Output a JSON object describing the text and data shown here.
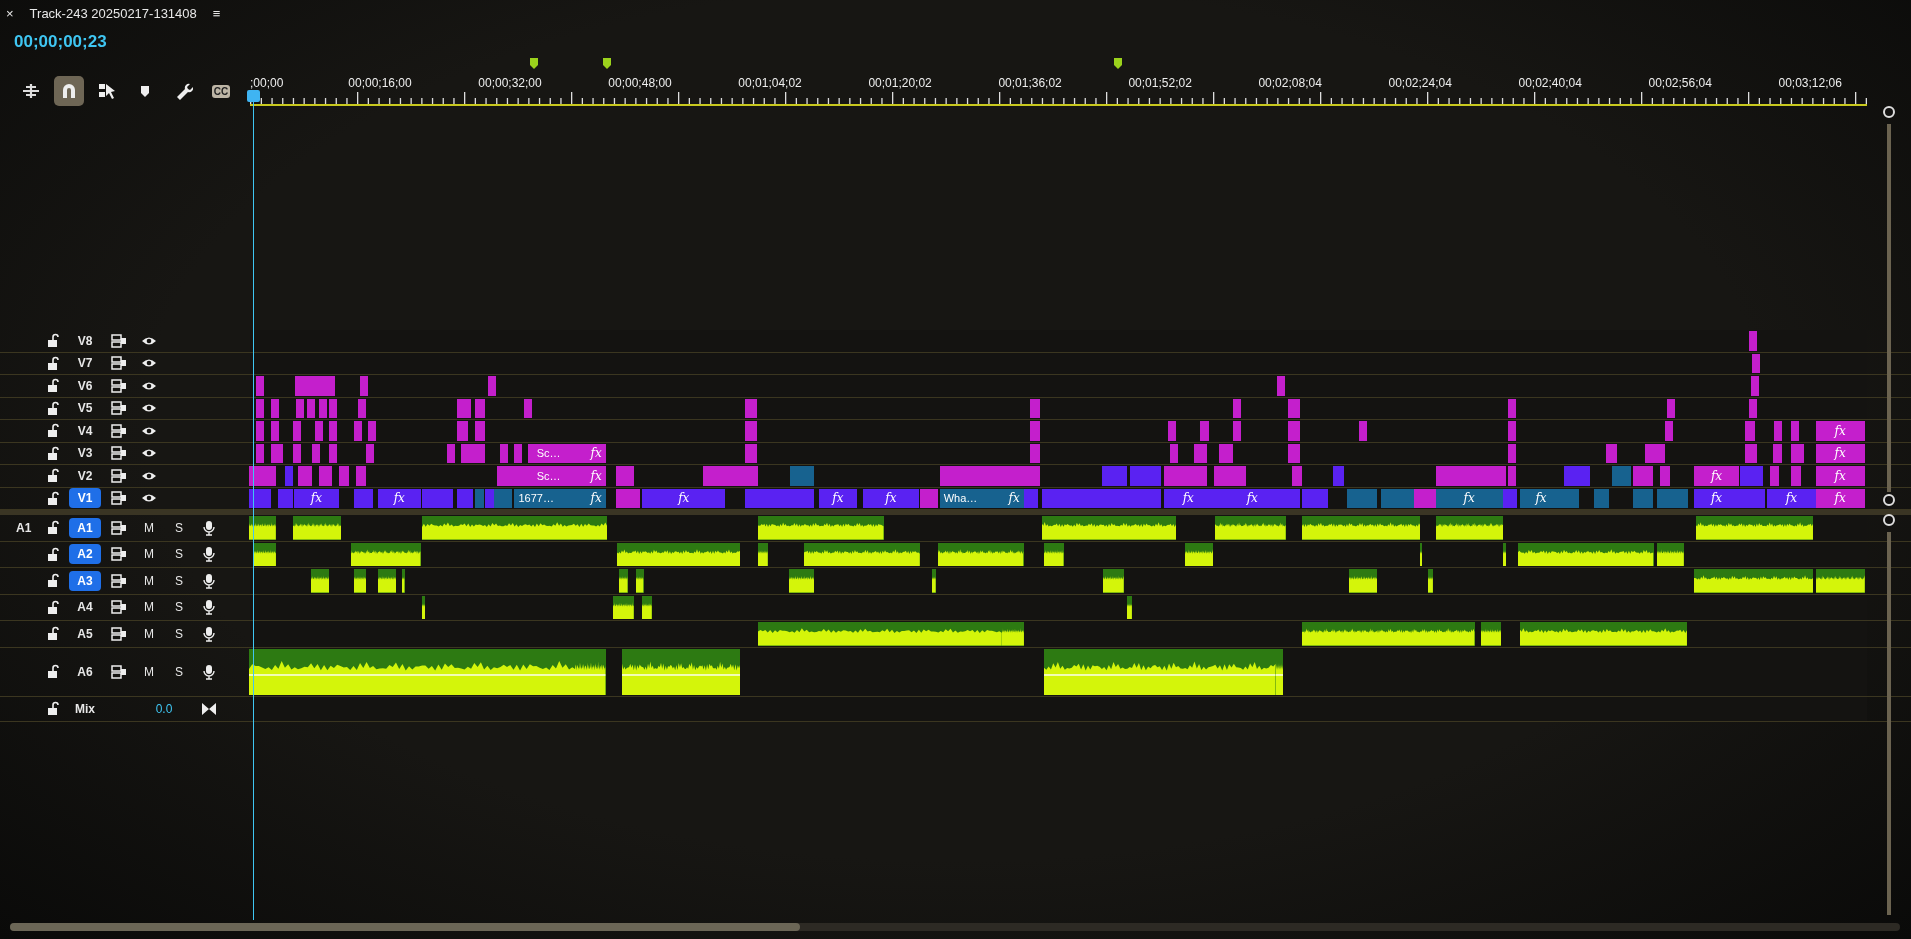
{
  "sequence": {
    "close": "×",
    "title": "Track-243 20250217-131408",
    "menu": "≡"
  },
  "timecode": "00;00;00;23",
  "tools": [
    {
      "kind": "nest",
      "on": false
    },
    {
      "kind": "snap",
      "on": true
    },
    {
      "kind": "linked",
      "on": false
    },
    {
      "kind": "marker",
      "on": false
    },
    {
      "kind": "settings",
      "on": false
    },
    {
      "kind": "captions",
      "label": "CC",
      "on": false
    }
  ],
  "ruler": {
    "labels": [
      ";00;00",
      "00;00;16;00",
      "00;00;32;00",
      "00;00;48;00",
      "00;01;04;02",
      "00;01;20;02",
      "00;01;36;02",
      "00;01;52;02",
      "00;02;08;04",
      "00;02;24;04",
      "00;02;40;04",
      "00;02;56;04",
      "00;03;12;06"
    ]
  },
  "video_tracks": [
    {
      "name": "V8",
      "selected": false
    },
    {
      "name": "V7",
      "selected": false
    },
    {
      "name": "V6",
      "selected": false
    },
    {
      "name": "V5",
      "selected": false
    },
    {
      "name": "V4",
      "selected": false,
      "clips": [
        {
          "fx": "fx",
          "color": "#c41fcc"
        }
      ]
    },
    {
      "name": "V3",
      "selected": false,
      "clips": [
        {
          "label": "Sc…",
          "fx": "fx",
          "color": "#c41fcc"
        },
        {
          "fx": "fx",
          "color": "#c41fcc"
        }
      ]
    },
    {
      "name": "V2",
      "selected": false,
      "clips": [
        {
          "label": "Sc…",
          "fx": "fx",
          "color": "#c41fcc"
        },
        {
          "fx": "fx",
          "color": "#c41fcc"
        },
        {
          "fx": "fx",
          "color": "#c41fcc"
        }
      ]
    },
    {
      "name": "V1",
      "selected": true,
      "clips": [
        {
          "fx": "fx",
          "color": "#5a22f2"
        },
        {
          "fx": "fx",
          "color": "#5a22f2"
        },
        {
          "label": "1677…",
          "fx": "fx",
          "color": "#17628f"
        },
        {
          "fx": "fx",
          "color": "#5a22f2"
        },
        {
          "fx": "fx",
          "color": "#5a22f2"
        },
        {
          "fx": "fx",
          "color": "#5a22f2"
        },
        {
          "label": "Wha…",
          "fx": "fx",
          "color": "#17628f"
        },
        {
          "fx": "fx",
          "color": "#5a22f2"
        },
        {
          "fx": "fx",
          "color": "#5a22f2"
        },
        {
          "fx": "fx",
          "color": "#17628f"
        },
        {
          "fx": "fx",
          "color": "#17628f"
        },
        {
          "fx": "fx",
          "color": "#5a22f2"
        },
        {
          "fx": "fx",
          "color": "#5a22f2"
        },
        {
          "fx": "fx",
          "color": "#c41fcc"
        }
      ]
    }
  ],
  "audio_tracks": [
    {
      "source": "A1",
      "name": "A1",
      "selected": true,
      "mute": "M",
      "solo": "S"
    },
    {
      "name": "A2",
      "selected": true,
      "mute": "M",
      "solo": "S"
    },
    {
      "name": "A3",
      "selected": true,
      "mute": "M",
      "solo": "S"
    },
    {
      "name": "A4",
      "selected": false,
      "mute": "M",
      "solo": "S"
    },
    {
      "name": "A5",
      "selected": false,
      "mute": "M",
      "solo": "S"
    },
    {
      "name": "A6",
      "selected": false,
      "mute": "M",
      "solo": "S"
    }
  ],
  "mix": {
    "name": "Mix",
    "value": "0.0"
  }
}
